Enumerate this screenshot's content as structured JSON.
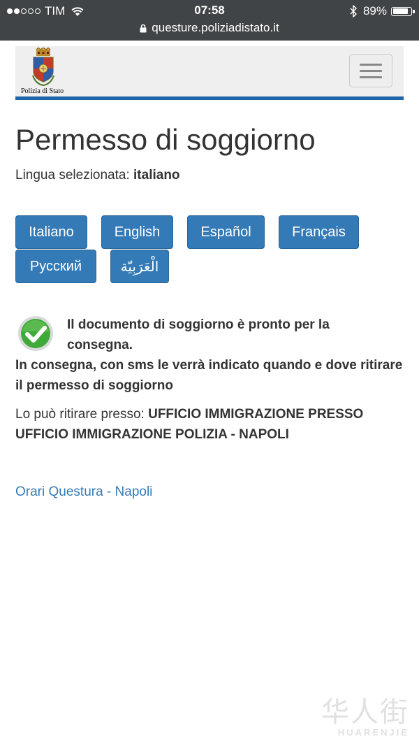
{
  "status_bar": {
    "carrier": "TIM",
    "time": "07:58",
    "battery": "89%",
    "battery_level": 0.89,
    "url": "questure.poliziadistato.it",
    "signal_dots_filled": 2,
    "signal_dots_total": 5
  },
  "header": {
    "logo_text": "Polizia di Stato",
    "menu_icon": "hamburger-icon"
  },
  "page": {
    "title": "Permesso di soggiorno",
    "language_label": "Lingua selezionata:",
    "language_value": "italiano"
  },
  "languages": [
    "Italiano",
    "English",
    "Español",
    "Français",
    "Русский",
    "الْعَرَبِيّة"
  ],
  "status": {
    "icon": "check-circle-icon",
    "headline": "Il documento di soggiorno è pronto per la consegna.",
    "detail": "In consegna, con sms le verrà indicato quando e dove ritirare il permesso di soggiorno",
    "pickup_label": "Lo può ritirare presso:",
    "pickup_place": "UFFICIO IMMIGRAZIONE PRESSO UFFICIO IMMIGRAZIONE POLIZIA - NAPOLI"
  },
  "links": {
    "orari": "Orari Questura - Napoli"
  },
  "watermark": {
    "cn": "华人街",
    "en": "HUARENJIE"
  },
  "colors": {
    "status_bar_bg": "#404446",
    "brand_blue": "#337ab7",
    "header_rule": "#1f64a6",
    "header_bg": "#efefef",
    "check_green": "#3faa3a"
  }
}
